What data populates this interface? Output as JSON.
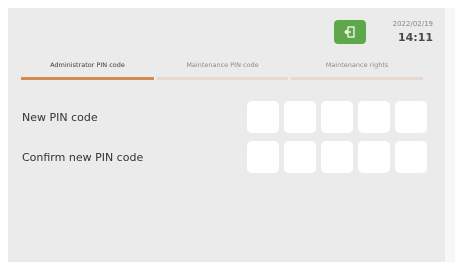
{
  "header": {
    "date": "2022/02/19",
    "time": "14:11",
    "logout_icon": "logout-icon",
    "accent_color": "#5ea74a"
  },
  "tabs": [
    {
      "label": "Administrator PIN code",
      "active": true
    },
    {
      "label": "Maintenance PIN code",
      "active": false
    },
    {
      "label": "Maintenance rights",
      "active": false
    }
  ],
  "form": {
    "new_pin_label": "New PIN code",
    "confirm_pin_label": "Confirm new PIN code",
    "digit_values": [
      "",
      "",
      "",
      "",
      ""
    ]
  },
  "colors": {
    "tab_active": "#d48b52",
    "tab_inactive": "#e7d9cf",
    "background": "#ebebeb"
  }
}
